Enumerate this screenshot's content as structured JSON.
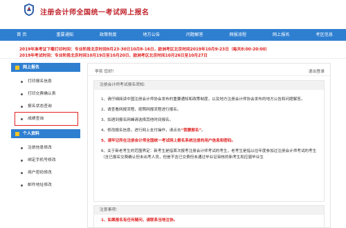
{
  "header": {
    "site_title": "注册会计师全国统一考试网上报名"
  },
  "nav": [
    {
      "label": "首 页"
    },
    {
      "label": "重要通知"
    },
    {
      "label": "政策制度"
    },
    {
      "label": "地方公告"
    },
    {
      "label": "问题解答"
    },
    {
      "label": "网报流程"
    },
    {
      "label": "网上报名"
    },
    {
      "label": "考区信息"
    }
  ],
  "notice": {
    "line1": "2019年准考证下载打印时间：专业阶段北京时间9月23-30日10月8-16日，欧洲考区北京时间2019年10月9-23日（每天8:00-20:00）",
    "line2": "2019年考试时间：专业阶段北京时间10月19日至10月20日，欧洲考区北京时间10月26日至10月27日"
  },
  "sidebar": {
    "section1": "网上报名",
    "items1": [
      "打印报名信息",
      "打印交费确认表",
      "报名状态查询",
      "成绩查询"
    ],
    "section2": "个人资料",
    "items2": [
      "注册信息修改",
      "绑定手机号修改",
      "用户密码修改",
      "邮件地址修改"
    ]
  },
  "main": {
    "greeting": "李奕 您好!",
    "logout": "退出登录",
    "box_title": "注册会计师考试报名须知:",
    "items": [
      "1、请仔细阅读中国注册会计师协会发布的重要通知和政策制度，以及地方注册会计师协会发布的地方公告和问题解答。",
      "2、请查看网报流程，按照网报流程进行报名。",
      "3、如遇到报名网峰请选择其他时间报名。",
      "4、修改报名信息，进行网上支付操作，请点击",
      "“我要报名”",
      "。",
      "5、请牢记所在注册会计师全国统一考试网上报名系统注册的用户信息和密码。",
      "6、关于新老考生的范围界定：新考生是指首次报考注册会计师考试的考生，老考生是指以往年度参加过注册会计师考试的考生（含已报名交费确认但未出考人员，但是不含已交费但未通过毕业证审核的新考生和应届毕业生"
    ],
    "notes_title": "注意事项：",
    "note1": "1、如果报名有任何疑问，请联系当地注协。"
  }
}
